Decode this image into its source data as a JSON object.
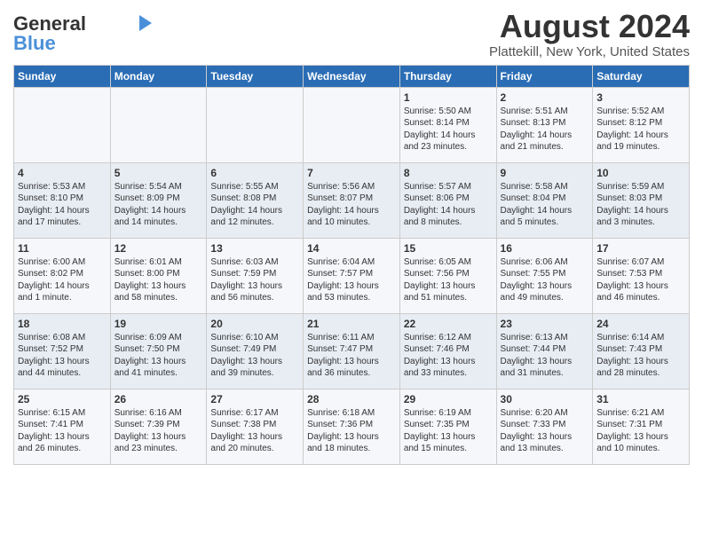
{
  "logo": {
    "part1": "General",
    "part2": "Blue",
    "arrow_color": "#4a90d9"
  },
  "title": "August 2024",
  "location": "Plattekill, New York, United States",
  "days_of_week": [
    "Sunday",
    "Monday",
    "Tuesday",
    "Wednesday",
    "Thursday",
    "Friday",
    "Saturday"
  ],
  "weeks": [
    [
      {
        "day": "",
        "content": ""
      },
      {
        "day": "",
        "content": ""
      },
      {
        "day": "",
        "content": ""
      },
      {
        "day": "",
        "content": ""
      },
      {
        "day": "1",
        "content": "Sunrise: 5:50 AM\nSunset: 8:14 PM\nDaylight: 14 hours\nand 23 minutes."
      },
      {
        "day": "2",
        "content": "Sunrise: 5:51 AM\nSunset: 8:13 PM\nDaylight: 14 hours\nand 21 minutes."
      },
      {
        "day": "3",
        "content": "Sunrise: 5:52 AM\nSunset: 8:12 PM\nDaylight: 14 hours\nand 19 minutes."
      }
    ],
    [
      {
        "day": "4",
        "content": "Sunrise: 5:53 AM\nSunset: 8:10 PM\nDaylight: 14 hours\nand 17 minutes."
      },
      {
        "day": "5",
        "content": "Sunrise: 5:54 AM\nSunset: 8:09 PM\nDaylight: 14 hours\nand 14 minutes."
      },
      {
        "day": "6",
        "content": "Sunrise: 5:55 AM\nSunset: 8:08 PM\nDaylight: 14 hours\nand 12 minutes."
      },
      {
        "day": "7",
        "content": "Sunrise: 5:56 AM\nSunset: 8:07 PM\nDaylight: 14 hours\nand 10 minutes."
      },
      {
        "day": "8",
        "content": "Sunrise: 5:57 AM\nSunset: 8:06 PM\nDaylight: 14 hours\nand 8 minutes."
      },
      {
        "day": "9",
        "content": "Sunrise: 5:58 AM\nSunset: 8:04 PM\nDaylight: 14 hours\nand 5 minutes."
      },
      {
        "day": "10",
        "content": "Sunrise: 5:59 AM\nSunset: 8:03 PM\nDaylight: 14 hours\nand 3 minutes."
      }
    ],
    [
      {
        "day": "11",
        "content": "Sunrise: 6:00 AM\nSunset: 8:02 PM\nDaylight: 14 hours\nand 1 minute."
      },
      {
        "day": "12",
        "content": "Sunrise: 6:01 AM\nSunset: 8:00 PM\nDaylight: 13 hours\nand 58 minutes."
      },
      {
        "day": "13",
        "content": "Sunrise: 6:03 AM\nSunset: 7:59 PM\nDaylight: 13 hours\nand 56 minutes."
      },
      {
        "day": "14",
        "content": "Sunrise: 6:04 AM\nSunset: 7:57 PM\nDaylight: 13 hours\nand 53 minutes."
      },
      {
        "day": "15",
        "content": "Sunrise: 6:05 AM\nSunset: 7:56 PM\nDaylight: 13 hours\nand 51 minutes."
      },
      {
        "day": "16",
        "content": "Sunrise: 6:06 AM\nSunset: 7:55 PM\nDaylight: 13 hours\nand 49 minutes."
      },
      {
        "day": "17",
        "content": "Sunrise: 6:07 AM\nSunset: 7:53 PM\nDaylight: 13 hours\nand 46 minutes."
      }
    ],
    [
      {
        "day": "18",
        "content": "Sunrise: 6:08 AM\nSunset: 7:52 PM\nDaylight: 13 hours\nand 44 minutes."
      },
      {
        "day": "19",
        "content": "Sunrise: 6:09 AM\nSunset: 7:50 PM\nDaylight: 13 hours\nand 41 minutes."
      },
      {
        "day": "20",
        "content": "Sunrise: 6:10 AM\nSunset: 7:49 PM\nDaylight: 13 hours\nand 39 minutes."
      },
      {
        "day": "21",
        "content": "Sunrise: 6:11 AM\nSunset: 7:47 PM\nDaylight: 13 hours\nand 36 minutes."
      },
      {
        "day": "22",
        "content": "Sunrise: 6:12 AM\nSunset: 7:46 PM\nDaylight: 13 hours\nand 33 minutes."
      },
      {
        "day": "23",
        "content": "Sunrise: 6:13 AM\nSunset: 7:44 PM\nDaylight: 13 hours\nand 31 minutes."
      },
      {
        "day": "24",
        "content": "Sunrise: 6:14 AM\nSunset: 7:43 PM\nDaylight: 13 hours\nand 28 minutes."
      }
    ],
    [
      {
        "day": "25",
        "content": "Sunrise: 6:15 AM\nSunset: 7:41 PM\nDaylight: 13 hours\nand 26 minutes."
      },
      {
        "day": "26",
        "content": "Sunrise: 6:16 AM\nSunset: 7:39 PM\nDaylight: 13 hours\nand 23 minutes."
      },
      {
        "day": "27",
        "content": "Sunrise: 6:17 AM\nSunset: 7:38 PM\nDaylight: 13 hours\nand 20 minutes."
      },
      {
        "day": "28",
        "content": "Sunrise: 6:18 AM\nSunset: 7:36 PM\nDaylight: 13 hours\nand 18 minutes."
      },
      {
        "day": "29",
        "content": "Sunrise: 6:19 AM\nSunset: 7:35 PM\nDaylight: 13 hours\nand 15 minutes."
      },
      {
        "day": "30",
        "content": "Sunrise: 6:20 AM\nSunset: 7:33 PM\nDaylight: 13 hours\nand 13 minutes."
      },
      {
        "day": "31",
        "content": "Sunrise: 6:21 AM\nSunset: 7:31 PM\nDaylight: 13 hours\nand 10 minutes."
      }
    ]
  ]
}
